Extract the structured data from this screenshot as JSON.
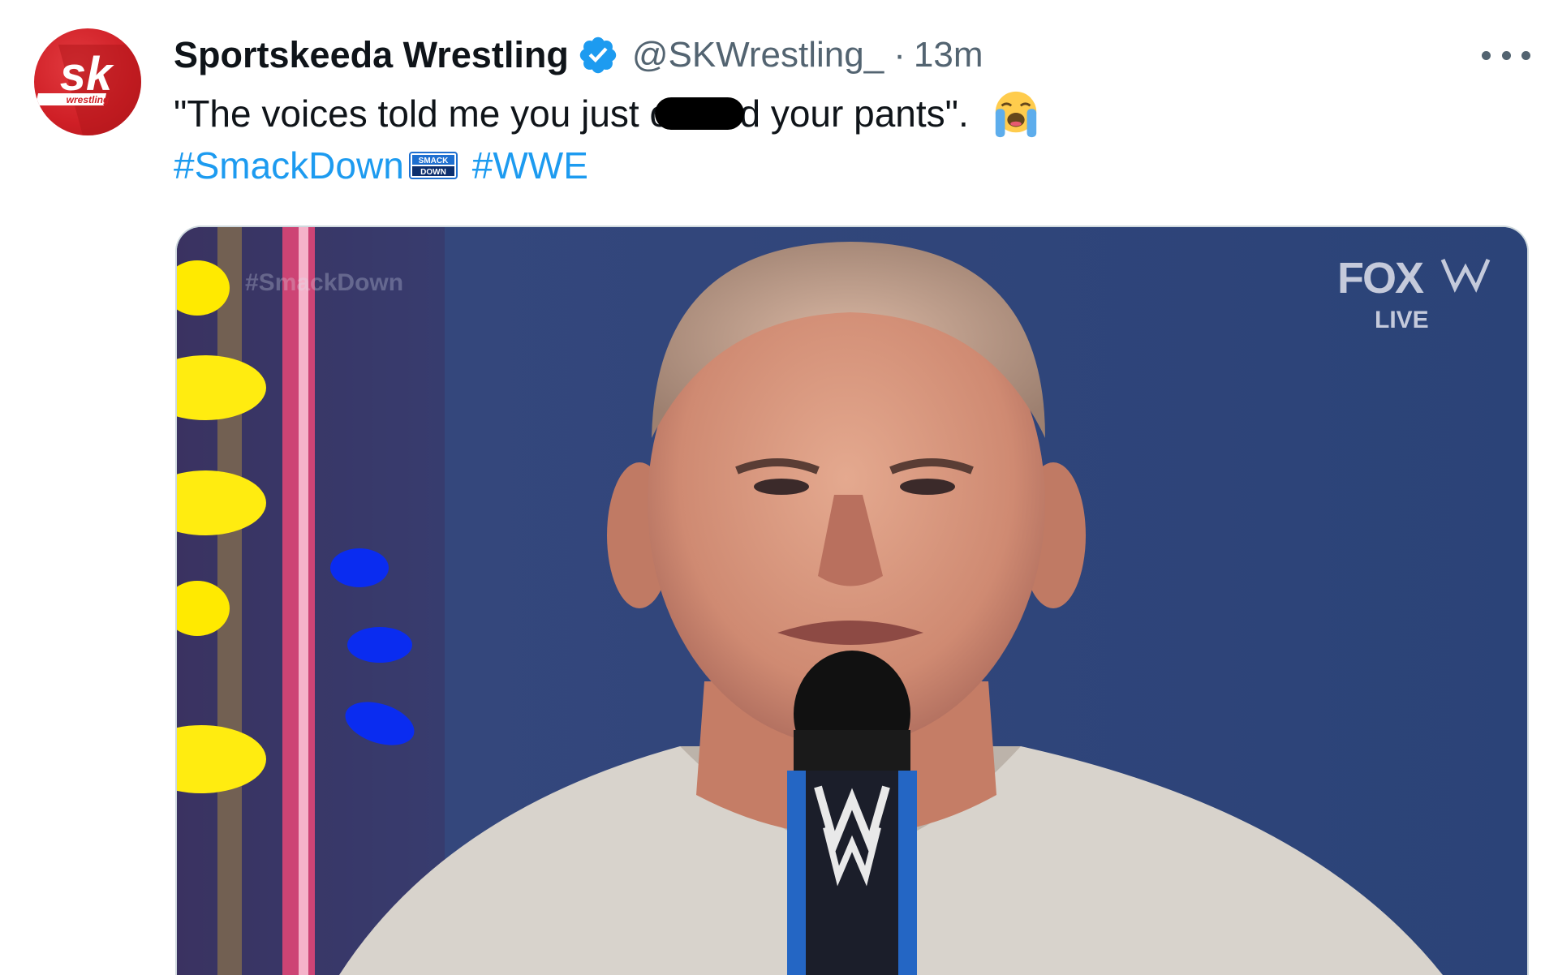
{
  "tweet": {
    "avatar_text": "sk",
    "avatar_subtext": "wrestling",
    "display_name": "Sportskeeda Wrestling",
    "handle": "@SKWrestling_",
    "separator": "·",
    "time": "13m",
    "text_before": "\"The voices told me you just c",
    "text_after": "d your pants\".",
    "emoji": "loudly-crying-face-emoji",
    "hashtags": [
      "#SmackDown",
      "#WWE"
    ],
    "smackdown_icon_text": "SMACK DOWN"
  },
  "media": {
    "watermark": "#SmackDown",
    "network": "FOX",
    "live_label": "LIVE"
  },
  "colors": {
    "brand_red": "#cf1f26",
    "verified_blue": "#1d9bf0",
    "link_blue": "#1d9bf0",
    "muted_gray": "#536471"
  }
}
